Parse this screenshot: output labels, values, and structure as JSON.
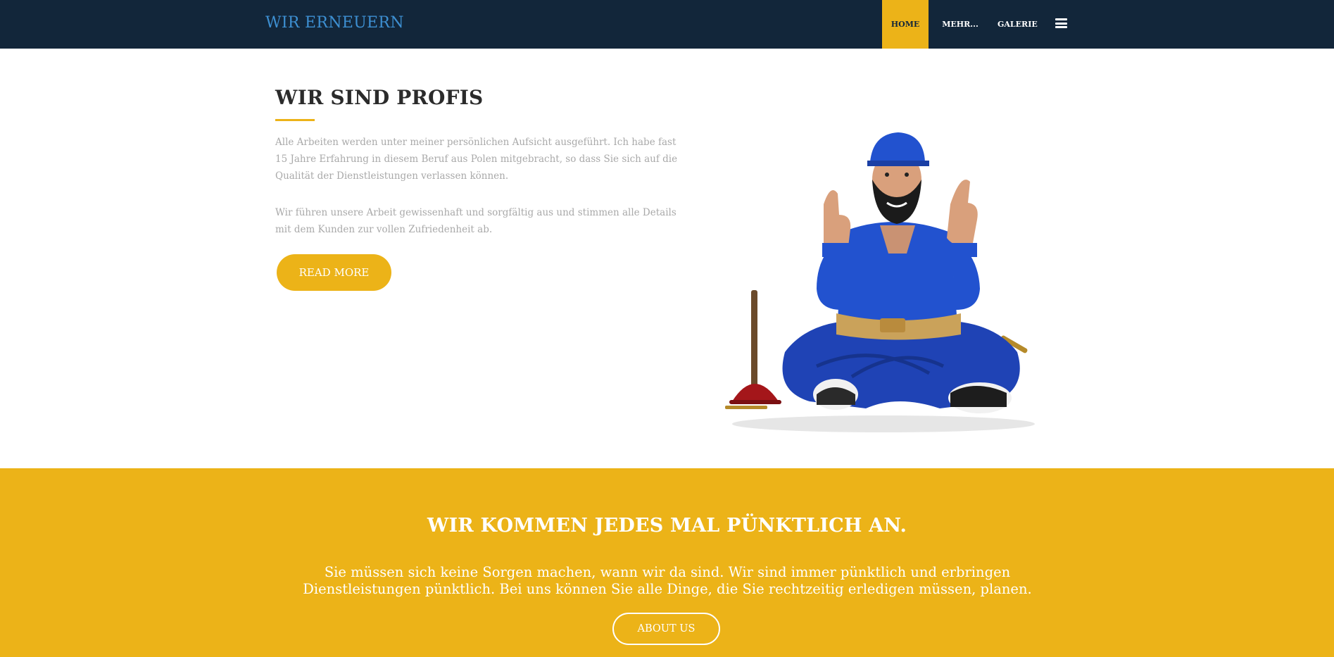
{
  "navbar": {
    "brand": "WIR ERNEUERN",
    "items": [
      {
        "label": "HOME",
        "active": true
      },
      {
        "label": "MEHR...",
        "has_dropdown": true
      },
      {
        "label": "GALERIE"
      }
    ],
    "menu_icon": "hamburger-menu-icon"
  },
  "hero": {
    "title": "WIR SIND PROFIS",
    "paragraph1": "Alle Arbeiten werden unter meiner persönlichen Aufsicht ausgeführt. Ich habe fast 15 Jahre Erfahrung in diesem Beruf aus Polen mitgebracht, so dass Sie sich auf die Qualität der Dienstleistungen verlassen können.",
    "paragraph2": "Wir führen unsere Arbeit gewissenhaft und sorgfältig aus und stimmen alle Details mit dem Kunden zur vollen Zufriedenheit ab.",
    "button_label": "READ MORE"
  },
  "band": {
    "title": "WIR KOMMEN JEDES MAL PÜNKTLICH AN.",
    "text": "Sie müssen sich keine Sorgen machen, wann wir da sind. Wir sind immer pünktlich und erbringen Dienstleistungen pünktlich. Bei uns können Sie alle Dinge, die Sie rechtzeitig erledigen müssen, planen.",
    "button_label": "ABOUT US"
  },
  "colors": {
    "navbar_bg": "#12263a",
    "brand": "#3d8fd1",
    "accent": "#ecb318",
    "heading": "#2b2b2b",
    "body_text": "#a9a9a9"
  }
}
